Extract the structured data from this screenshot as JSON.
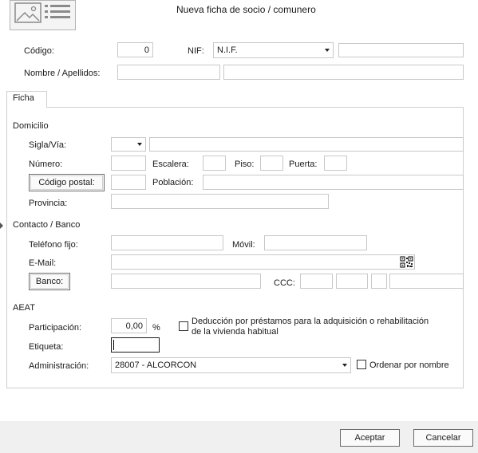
{
  "header": {
    "title": "Nueva ficha de socio / comunero"
  },
  "top": {
    "codigo_label": "Código:",
    "codigo_value": "0",
    "nif_label": "NIF:",
    "nif_type": "N.I.F.",
    "nif_value": "",
    "nombre_label": "Nombre / Apellidos:",
    "nombre_value": "",
    "apellidos_value": ""
  },
  "tabs": [
    {
      "label": "Ficha"
    }
  ],
  "domicilio": {
    "section_label": "Domicilio",
    "sigla_label": "Sigla/Vía:",
    "sigla_value": "",
    "via_value": "",
    "numero_label": "Número:",
    "escalera_label": "Escalera:",
    "piso_label": "Piso:",
    "puerta_label": "Puerta:",
    "codigo_postal_button": "Código postal:",
    "poblacion_label": "Población:",
    "provincia_label": "Provincia:"
  },
  "contacto": {
    "section_label": "Contacto / Banco",
    "telefono_label": "Teléfono fijo:",
    "movil_label": "Móvil:",
    "email_label": "E-Mail:",
    "banco_button": "Banco:",
    "ccc_label": "CCC:"
  },
  "aeat": {
    "section_label": "AEAT",
    "participacion_label": "Participación:",
    "participacion_value": "0,00",
    "percent_sign": "%",
    "deduccion_label_line1": "Deducción por préstamos para la adquisición o rehabilitación",
    "deduccion_label_line2": "de la vivienda habitual",
    "deduccion_checked": false,
    "etiqueta_label": "Etiqueta:",
    "etiqueta_value": "",
    "administracion_label": "Administración:",
    "administracion_value": "28007 - ALCORCON",
    "ordenar_label": "Ordenar por nombre",
    "ordenar_checked": false
  },
  "footer": {
    "accept_label": "Aceptar",
    "cancel_label": "Cancelar"
  },
  "icons": {
    "card": "image-card-icon",
    "qr": "qr-code-icon",
    "dropdown": "chevron-down-icon",
    "side_arrow": "chevron-right-icon"
  }
}
